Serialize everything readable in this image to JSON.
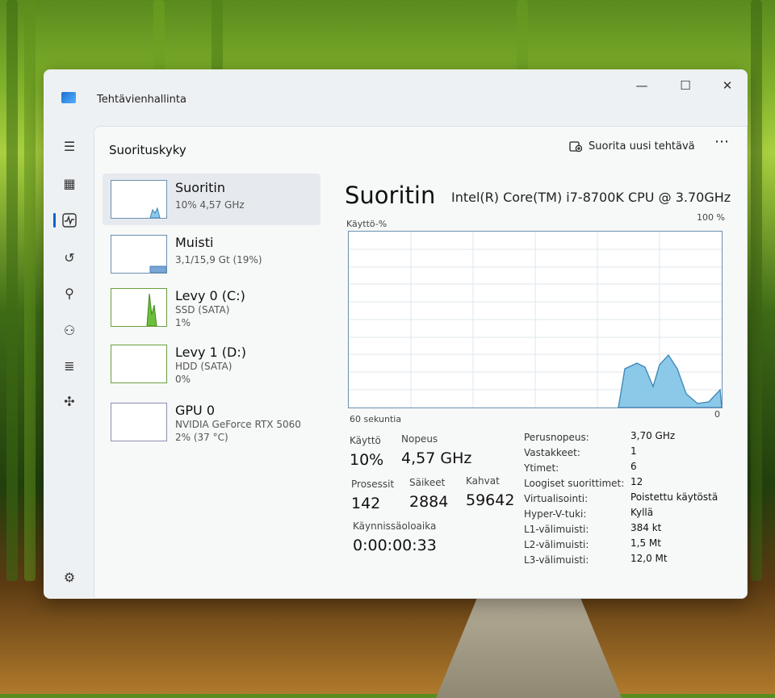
{
  "app": {
    "title": "Tehtävienhallinta"
  },
  "window_controls": {
    "minimize": "—",
    "maximize": "☐",
    "close": "✕"
  },
  "nav": [
    "hamburger-icon",
    "processes-icon",
    "performance-icon",
    "history-icon",
    "startup-icon",
    "users-icon",
    "details-icon",
    "services-icon",
    "settings-icon"
  ],
  "header": {
    "title": "Suorituskyky",
    "run_task": "Suorita uusi tehtävä",
    "more": "⋯"
  },
  "resources": [
    {
      "name": "Suoritin",
      "line1": "10% 4,57 GHz",
      "line2": ""
    },
    {
      "name": "Muisti",
      "line1": "3,1/15,9 Gt (19%)",
      "line2": ""
    },
    {
      "name": "Levy 0 (C:)",
      "line1": "SSD (SATA)",
      "line2": "1%"
    },
    {
      "name": "Levy 1 (D:)",
      "line1": "HDD (SATA)",
      "line2": "0%"
    },
    {
      "name": "GPU 0",
      "line1": "NVIDIA GeForce RTX 5060",
      "line2": "2% (37 °C)"
    }
  ],
  "detail": {
    "title": "Suoritin",
    "cpu_name": "Intel(R) Core(TM) i7-8700K CPU @ 3.70GHz",
    "graph_label": "Käyttö-%",
    "graph_max": "100 %",
    "graph_time": "60 sekuntia",
    "graph_min": "0",
    "stats": {
      "usage_label": "Käyttö",
      "usage_value": "10%",
      "speed_label": "Nopeus",
      "speed_value": "4,57 GHz",
      "processes_label": "Prosessit",
      "processes_value": "142",
      "threads_label": "Säikeet",
      "threads_value": "2884",
      "handles_label": "Kahvat",
      "handles_value": "59642",
      "uptime_label": "Käynnissäoloaika",
      "uptime_value": "0:00:00:33"
    },
    "specs": [
      {
        "label": "Perusnopeus:",
        "value": "3,70 GHz"
      },
      {
        "label": "Vastakkeet:",
        "value": "1"
      },
      {
        "label": "Ytimet:",
        "value": "6"
      },
      {
        "label": "Loogiset suorittimet:",
        "value": "12"
      },
      {
        "label": "Virtualisointi:",
        "value": "Poistettu käytöstä"
      },
      {
        "label": "Hyper-V-tuki:",
        "value": "Kyllä"
      },
      {
        "label": "L1-välimuisti:",
        "value": "384 kt"
      },
      {
        "label": "L2-välimuisti:",
        "value": "1,5 Mt"
      },
      {
        "label": "L3-välimuisti:",
        "value": "12,0 Mt"
      }
    ]
  },
  "colors": {
    "graph_fill": "#8cc8e8",
    "graph_line": "#3a86b8",
    "accent": "#0a64c8",
    "memory_fill": "#7aa6d6",
    "disk_fill": "#6bbf3a"
  }
}
